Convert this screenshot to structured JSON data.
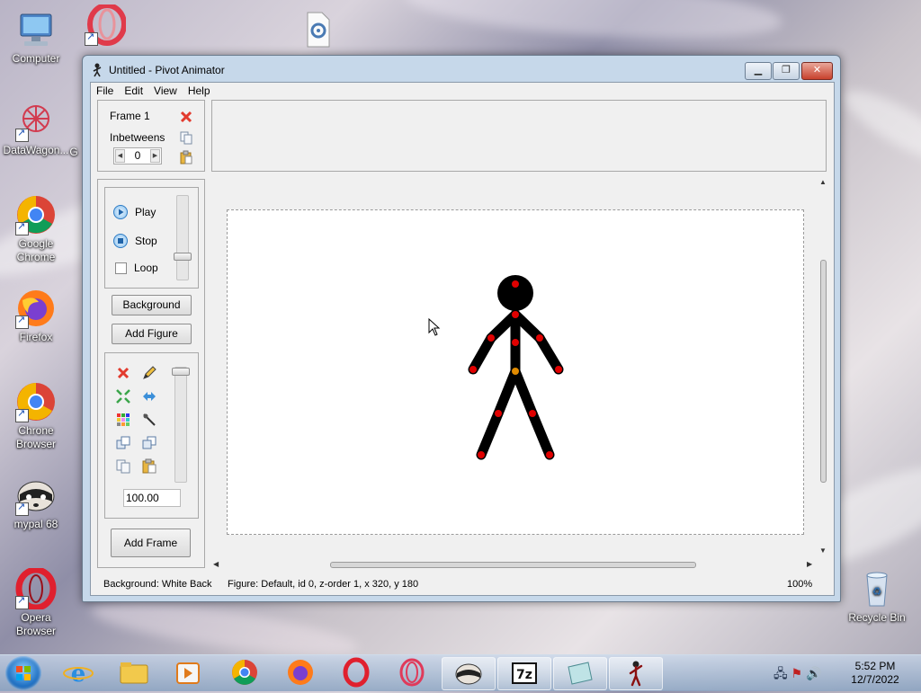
{
  "desktop": {
    "icons": [
      {
        "label": "Computer"
      },
      {
        "label": "DataWagon..."
      },
      {
        "label": "Google Chrome"
      },
      {
        "label": "Firefox"
      },
      {
        "label": "Chrone Browser"
      },
      {
        "label": "mypal 68"
      },
      {
        "label": "Opera Browser"
      },
      {
        "label": "Recycle Bin"
      }
    ],
    "cut_label_g": "G"
  },
  "window": {
    "title": "Untitled - Pivot Animator",
    "menu": [
      "File",
      "Edit",
      "View",
      "Help"
    ],
    "frame": {
      "label": "Frame 1",
      "inbetweens_label": "Inbetweens",
      "inbetweens_value": "0"
    },
    "playback": {
      "play": "Play",
      "stop": "Stop",
      "loop": "Loop",
      "loop_checked": false
    },
    "buttons": {
      "background": "Background",
      "add_figure": "Add Figure",
      "add_frame": "Add Frame"
    },
    "scale_value": "100.00",
    "status": {
      "background": "Background: White Back",
      "figure": "Figure: Default,  id 0,  z-order 1,  x 320, y 180",
      "zoom": "100%"
    },
    "figure": {
      "name": "Default",
      "joint_color": "#e00000",
      "origin_color": "#e08a00",
      "body_color": "#000000"
    }
  },
  "taskbar": {
    "apps": [
      "internet-explorer",
      "file-explorer",
      "media-player",
      "google-chrome",
      "firefox",
      "opera",
      "opera-gx",
      "mypal",
      "7-zip",
      "notepad",
      "pivot-animator"
    ],
    "active": "pivot-animator",
    "time": "5:52 PM",
    "date": "12/7/2022"
  }
}
